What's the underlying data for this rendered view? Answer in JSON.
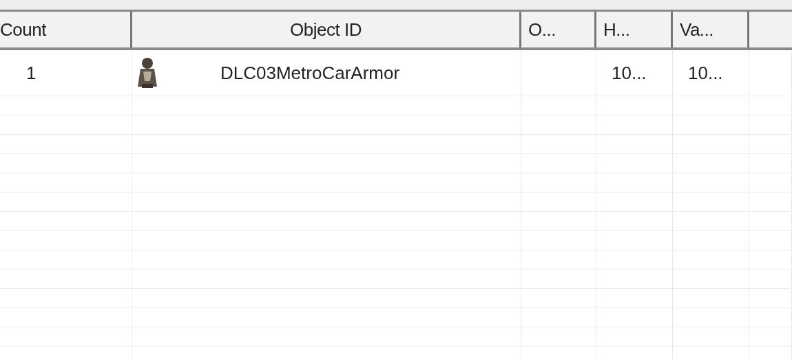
{
  "table": {
    "columns": [
      {
        "label": "Count"
      },
      {
        "label": "Object ID"
      },
      {
        "label": "O..."
      },
      {
        "label": "H..."
      },
      {
        "label": "Va..."
      }
    ],
    "rows": [
      {
        "count": "1",
        "object_id": "DLC03MetroCarArmor",
        "column_4": "10...",
        "column_5": "10..."
      }
    ]
  }
}
